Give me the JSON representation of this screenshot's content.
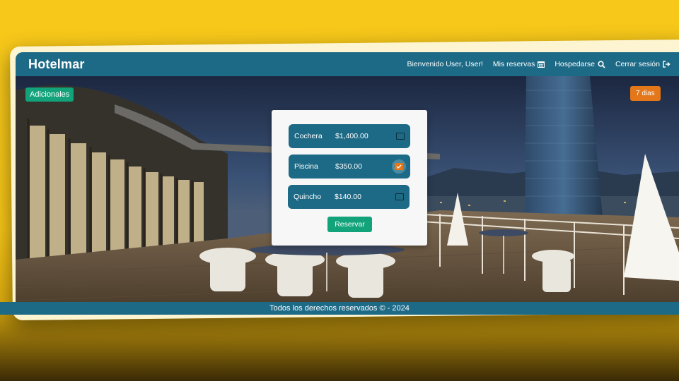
{
  "navbar": {
    "brand": "Hotelmar",
    "welcome": "Bienvenido User, User!",
    "links": [
      {
        "label": "Mis reservas",
        "icon": "calendar-icon"
      },
      {
        "label": "Hospedarse",
        "icon": "search-icon"
      },
      {
        "label": "Cerrar sesión",
        "icon": "logout-icon"
      }
    ]
  },
  "badges": {
    "left": "Adicionales",
    "right": "7 dias"
  },
  "extras": [
    {
      "name": "Cochera",
      "price": "$1,400.00",
      "checked": false
    },
    {
      "name": "Piscina",
      "price": "$350.00",
      "checked": true
    },
    {
      "name": "Quincho",
      "price": "$140.00",
      "checked": false
    }
  ],
  "reserve_button": "Reservar",
  "footer": "Todos los derechos reservados © - 2024",
  "colors": {
    "navbar": "#1d6a87",
    "accent_green": "#12a37b",
    "accent_orange": "#e3771a",
    "background_yellow": "#f5c518"
  }
}
